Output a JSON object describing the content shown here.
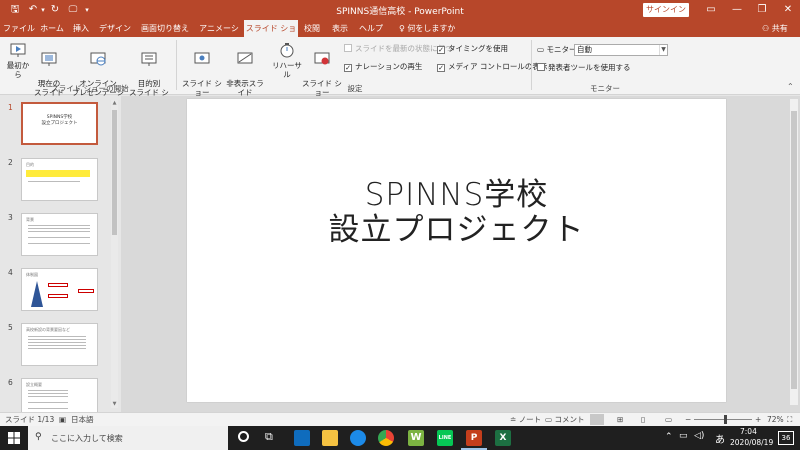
{
  "window": {
    "title": "SPINNS通信高校 - PowerPoint",
    "signin": "サインイン",
    "minimize": "—",
    "restore": "❐",
    "close": "✕",
    "ribbon_options": "▭",
    "qa_save": "🖫",
    "qa_undo": "↶",
    "qa_redo": "↻",
    "qa_customize": "▾"
  },
  "tabs": [
    "ファイル",
    "ホーム",
    "挿入",
    "デザイン",
    "画面切り替え",
    "アニメーション",
    "スライド ショー",
    "校閲",
    "表示",
    "ヘルプ"
  ],
  "tellme": "何をしますか",
  "share": "共有",
  "ribbon": {
    "start_group": {
      "label": "スライド ショーの開始",
      "from_start": "最初から",
      "from_current": "現在の\nスライドから",
      "online": "オンライン\nプレゼンテーション",
      "custom": "目的別\nスライド ショー"
    },
    "setup_group": {
      "label": "設定",
      "setup": "スライド ショー\nの設定",
      "hide": "非表示スライド\nに設定",
      "rehearse": "リハーサル",
      "record": "スライド ショー\nの記録",
      "keep_updated": "スライドを最新の状態に保つ",
      "narration": "ナレーションの再生",
      "timings": "タイミングを使用",
      "media": "メディア コントロールの表示"
    },
    "monitor_group": {
      "label": "モニター",
      "monitor_label": "モニター:",
      "monitor_value": "自動",
      "presenter": "発表者ツールを使用する"
    }
  },
  "thumbnails": [
    {
      "num": "1",
      "title": "SPINNS学校\n設立プロジェクト"
    },
    {
      "num": "2",
      "title": "目的"
    },
    {
      "num": "3",
      "title": "背景"
    },
    {
      "num": "4",
      "title": "体制図"
    },
    {
      "num": "5",
      "title": "高校新設の背景要因など"
    },
    {
      "num": "6",
      "title": "設立概要"
    }
  ],
  "slide": {
    "line1": "SPINNS学校",
    "line2": "設立プロジェクト"
  },
  "status": {
    "slide_info": "スライド 1/13",
    "language": "日本語",
    "notes": "ノート",
    "comments": "コメント",
    "zoom": "72%",
    "zoom_fraction": 0.72
  },
  "taskbar": {
    "search_placeholder": "ここに入力して検索",
    "time": "7:04",
    "date": "2020/08/19",
    "ime": "あ",
    "notification_count": "36"
  },
  "colors": {
    "accent": "#b7472a",
    "taskbar": "#1f1f1f"
  }
}
